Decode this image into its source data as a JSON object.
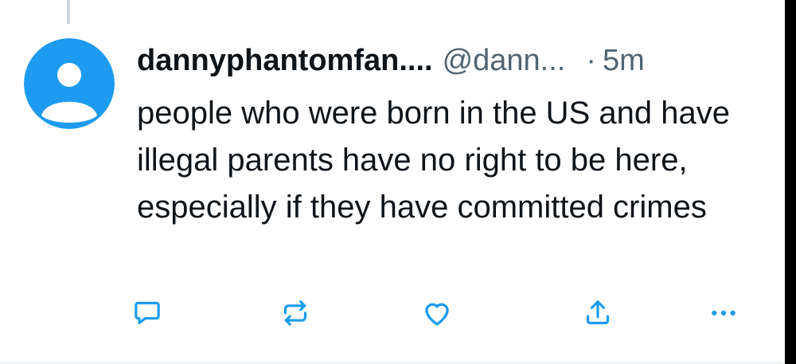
{
  "tweet": {
    "display_name": "dannyphantomfan....",
    "handle": "@dann...",
    "separator": "·",
    "time": "5m",
    "text": "people who were born in the US and have illegal parents have no right to be here, especially if they have committed crimes"
  },
  "avatar": {
    "icon": "default-user-avatar-icon",
    "background_color": "#1d9bf0",
    "figure_color": "#ffffff"
  },
  "actions": [
    {
      "name": "reply",
      "icon": "reply-icon"
    },
    {
      "name": "repost",
      "icon": "repost-icon"
    },
    {
      "name": "like",
      "icon": "heart-icon"
    },
    {
      "name": "share",
      "icon": "share-icon"
    },
    {
      "name": "more",
      "icon": "more-icon"
    }
  ],
  "colors": {
    "text_primary": "#0f1419",
    "text_secondary": "#536471",
    "accent": "#1d9bf0",
    "thread_line": "#cfd9de"
  }
}
